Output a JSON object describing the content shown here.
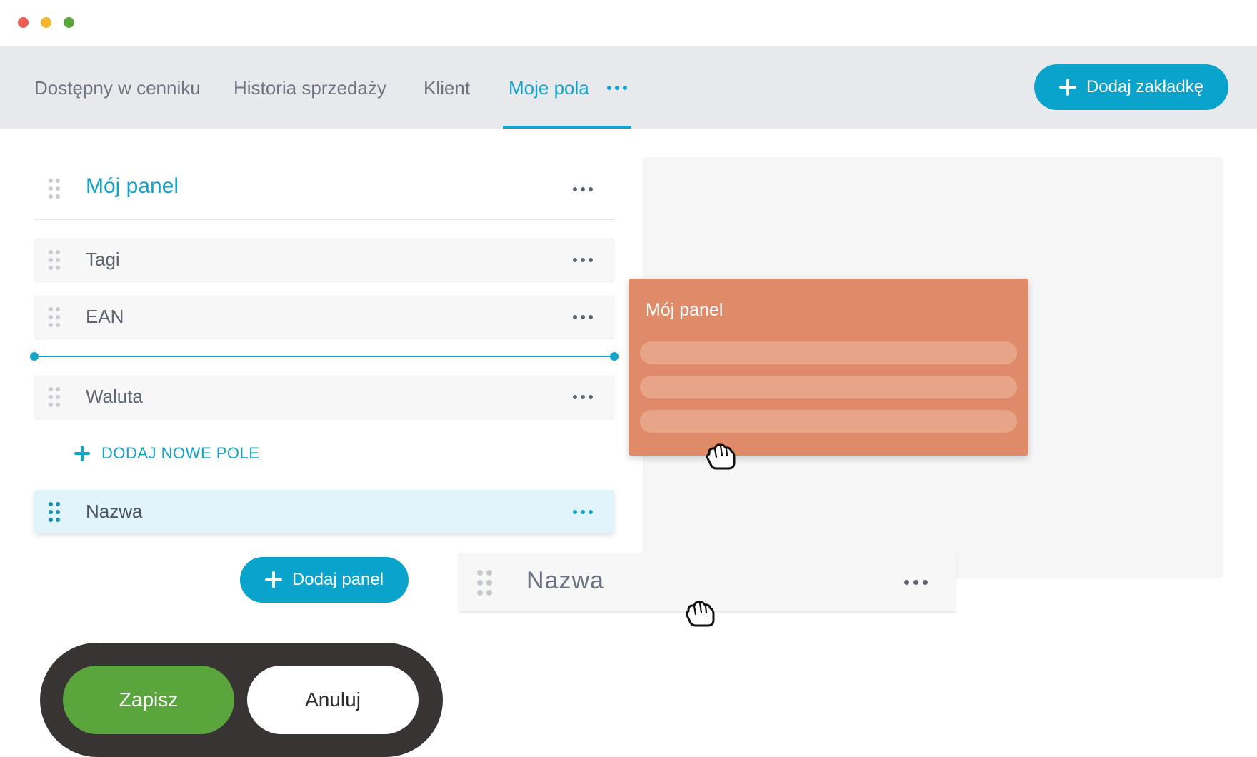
{
  "tabs": [
    {
      "label": "Dostępny w cenniku"
    },
    {
      "label": "Historia sprzedaży"
    },
    {
      "label": "Klient"
    },
    {
      "label": "Moje pola",
      "active": true
    }
  ],
  "tab_more_icon": "more-horizontal-icon",
  "add_tab_button": {
    "label": "Dodaj zakładkę",
    "icon": "plus-icon"
  },
  "panel": {
    "title": "Mój panel",
    "fields": [
      {
        "label": "Tagi"
      },
      {
        "label": "EAN"
      },
      {
        "label": "Waluta"
      }
    ],
    "add_field_label": "DODAJ NOWE POLE",
    "selected_field": {
      "label": "Nazwa"
    }
  },
  "add_panel_button": {
    "label": "Dodaj panel",
    "icon": "plus-icon"
  },
  "dragged_panel": {
    "title": "Mój panel",
    "color": "#df8a68"
  },
  "dragged_field": {
    "label": "Nazwa"
  },
  "actions": {
    "save_label": "Zapisz",
    "cancel_label": "Anuluj"
  },
  "colors": {
    "accent": "#0aa3cb",
    "save": "#5aa63c",
    "action_bar": "#383433"
  }
}
